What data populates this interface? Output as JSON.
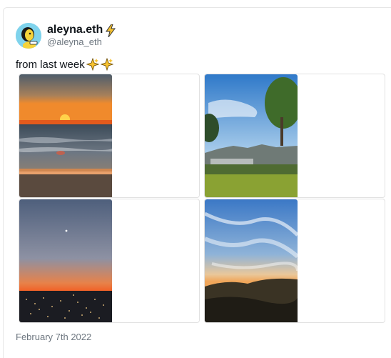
{
  "author": {
    "display_name": "aleyna.eth",
    "handle": "@aleyna_eth",
    "avatar_icon": "avatar-illustration-icon",
    "badge_icon": "lightning-bolt-icon"
  },
  "tweet": {
    "text": "from last week",
    "emoji": [
      "sparkles-icon",
      "sparkles-icon"
    ],
    "date": "February 7th 2022"
  },
  "media": [
    {
      "name": "sunset-over-ocean-photo"
    },
    {
      "name": "hollywood-hills-park-photo"
    },
    {
      "name": "city-lights-twilight-photo"
    },
    {
      "name": "wispy-clouds-sunset-photo"
    }
  ],
  "colors": {
    "text": "#0f1419",
    "muted": "#6e7780",
    "border": "#e1e1e1",
    "avatar_bg": "#7fd3ec",
    "bolt": "#f7c230"
  }
}
